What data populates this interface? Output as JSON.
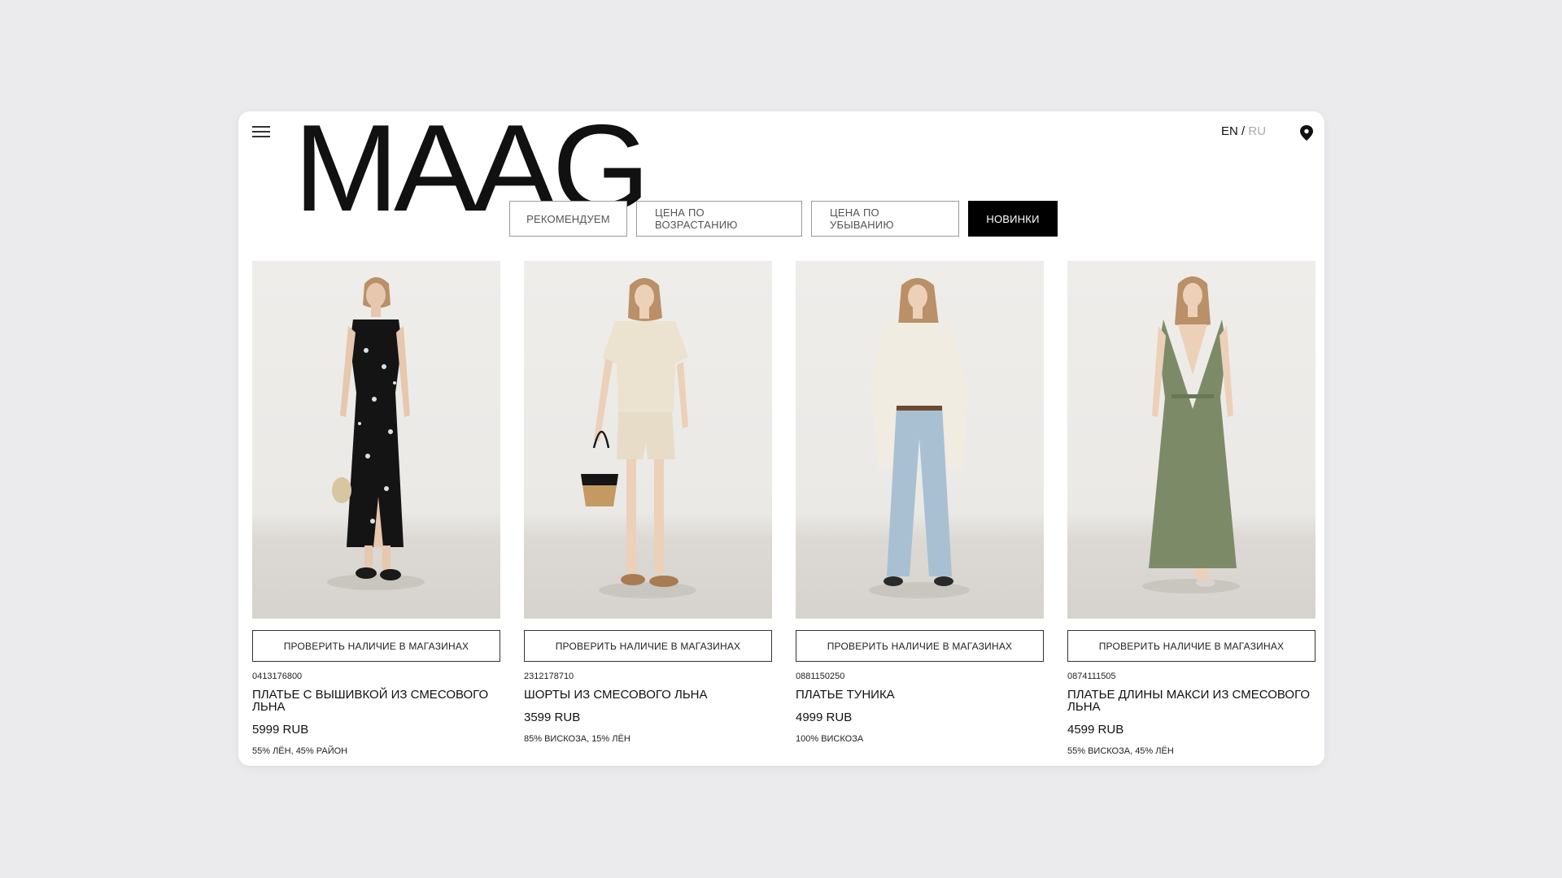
{
  "brand": {
    "logo": "MAAG"
  },
  "header": {
    "lang_en": "EN",
    "lang_separator": "/",
    "lang_ru": "RU"
  },
  "sort_options": [
    {
      "label": "РЕКОМЕНДУЕМ",
      "selected": false
    },
    {
      "label": "ЦЕНА ПО ВОЗРАСТАНИЮ",
      "selected": false
    },
    {
      "label": "ЦЕНА ПО УБЫВАНИЮ",
      "selected": false
    },
    {
      "label": "НОВИНКИ",
      "selected": true
    }
  ],
  "products": [
    {
      "check_label": "ПРОВЕРИТЬ НАЛИЧИЕ В МАГАЗИНАХ",
      "sku": "0413176800",
      "name": "ПЛАТЬЕ С ВЫШИВКОЙ ИЗ СМЕСОВОГО ЛЬНА",
      "price": "5999 RUB",
      "composition": "55% ЛЁН, 45% РАЙОН"
    },
    {
      "check_label": "ПРОВЕРИТЬ НАЛИЧИЕ В МАГАЗИНАХ",
      "sku": "2312178710",
      "name": "ШОРТЫ ИЗ СМЕСОВОГО ЛЬНА",
      "price": "3599 RUB",
      "composition": "85% ВИСКОЗА, 15% ЛЁН"
    },
    {
      "check_label": "ПРОВЕРИТЬ НАЛИЧИЕ В МАГАЗИНАХ",
      "sku": "0881150250",
      "name": "ПЛАТЬЕ ТУНИКА",
      "price": "4999 RUB",
      "composition": "100% ВИСКОЗА"
    },
    {
      "check_label": "ПРОВЕРИТЬ НАЛИЧИЕ В МАГАЗИНАХ",
      "sku": "0874111505",
      "name": "ПЛАТЬЕ ДЛИНЫ МАКСИ ИЗ СМЕСОВОГО ЛЬНА",
      "price": "4599 RUB",
      "composition": "55% ВИСКОЗА, 45% ЛЁН"
    }
  ],
  "colors": {
    "page_background": "#ebebee",
    "selected_sort_background": "#000000",
    "dress_black": "#141414",
    "linen_beige": "#e8dfcc",
    "denim_blue": "#a9c0d2",
    "olive_green": "#7d8a68"
  },
  "icons": [
    "hamburger-menu-icon",
    "location-pin-icon"
  ]
}
